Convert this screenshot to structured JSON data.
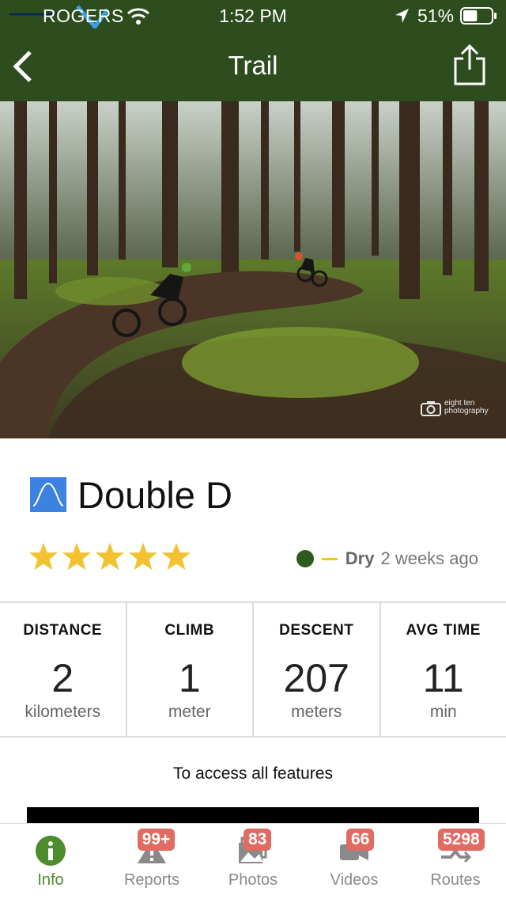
{
  "status_bar": {
    "carrier": "ROGERS",
    "time": "1:52 PM",
    "battery_percent": "51%",
    "battery_level": 0.51
  },
  "nav": {
    "title": "Trail",
    "back_icon": "chevron-left-icon",
    "share_icon": "share-icon"
  },
  "hero": {
    "credit_line1": "eight ten",
    "credit_line2": "photography"
  },
  "trail": {
    "name": "Double D",
    "difficulty_icon": "wave-icon",
    "rating": 5,
    "rating_max": 5,
    "condition_status": "Dry",
    "condition_time": "2 weeks ago",
    "colors": {
      "nav_bg": "#2e4d1e",
      "star": "#f2c230",
      "condition_dot": "#2d5a1d",
      "condition_dash": "#f2c230",
      "difficulty_icon": "#3c82e0"
    }
  },
  "stats": [
    {
      "label": "DISTANCE",
      "value": "2",
      "unit": "kilometers"
    },
    {
      "label": "CLIMB",
      "value": "1",
      "unit": "meter"
    },
    {
      "label": "DESCENT",
      "value": "207",
      "unit": "meters"
    },
    {
      "label": "AVG TIME",
      "value": "11",
      "unit": "min"
    }
  ],
  "access_text": "To access all features",
  "tabs": [
    {
      "label": "Info",
      "icon": "info-icon",
      "badge": ""
    },
    {
      "label": "Reports",
      "icon": "warning-icon",
      "badge": "99+"
    },
    {
      "label": "Photos",
      "icon": "photos-icon",
      "badge": "83"
    },
    {
      "label": "Videos",
      "icon": "video-icon",
      "badge": "66"
    },
    {
      "label": "Routes",
      "icon": "routes-icon",
      "badge": "5298"
    }
  ]
}
